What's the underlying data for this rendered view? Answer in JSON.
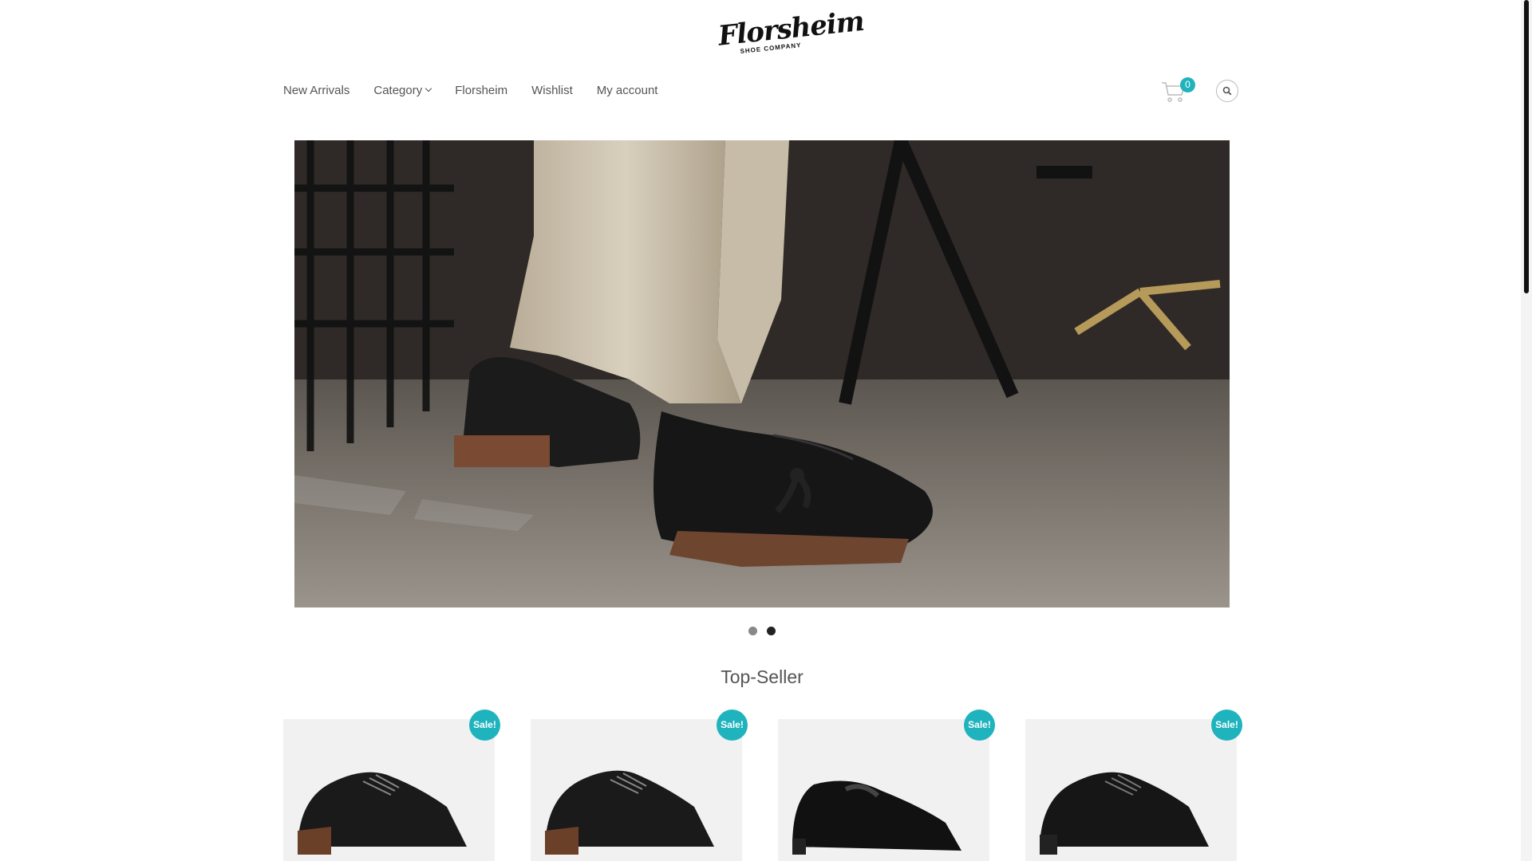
{
  "logo": {
    "name": "Florsheim",
    "tagline": "SHOE COMPANY"
  },
  "nav": {
    "items": [
      {
        "label": "New Arrivals"
      },
      {
        "label": "Category"
      },
      {
        "label": "Florsheim"
      },
      {
        "label": "Wishlist"
      },
      {
        "label": "My account"
      }
    ]
  },
  "cart": {
    "count": "0",
    "icon": "cart-icon"
  },
  "search": {
    "icon": "search-icon"
  },
  "slider": {
    "slides": 2,
    "active_slide": 2
  },
  "top_seller": {
    "title": "Top-Seller",
    "products": [
      {
        "badge": "Sale!"
      },
      {
        "badge": "Sale!"
      },
      {
        "badge": "Sale!"
      },
      {
        "badge": "Sale!"
      }
    ]
  },
  "colors": {
    "accent": "#1fb3be",
    "text": "#555555"
  }
}
